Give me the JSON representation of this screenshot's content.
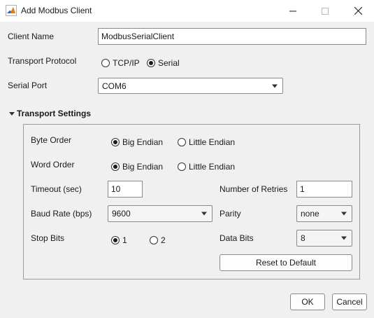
{
  "window": {
    "title": "Add Modbus Client"
  },
  "client_name": {
    "label": "Client Name",
    "value": "ModbusSerialClient"
  },
  "transport_protocol": {
    "label": "Transport Protocol",
    "options": [
      "TCP/IP",
      "Serial"
    ],
    "selected": "Serial"
  },
  "serial_port": {
    "label": "Serial Port",
    "value": "COM6"
  },
  "transport_settings": {
    "header": "Transport Settings",
    "byte_order": {
      "label": "Byte Order",
      "options": [
        "Big Endian",
        "Little Endian"
      ],
      "selected": "Big Endian"
    },
    "word_order": {
      "label": "Word Order",
      "options": [
        "Big Endian",
        "Little Endian"
      ],
      "selected": "Big Endian"
    },
    "timeout": {
      "label": "Timeout (sec)",
      "value": "10"
    },
    "retries": {
      "label": "Number of Retries",
      "value": "1"
    },
    "baud_rate": {
      "label": "Baud Rate (bps)",
      "value": "9600"
    },
    "parity": {
      "label": "Parity",
      "value": "none"
    },
    "stop_bits": {
      "label": "Stop Bits",
      "options": [
        "1",
        "2"
      ],
      "selected": "1"
    },
    "data_bits": {
      "label": "Data Bits",
      "value": "8"
    },
    "reset_label": "Reset to Default"
  },
  "buttons": {
    "ok": "OK",
    "cancel": "Cancel"
  },
  "colors": {
    "window_bg": "#f0f0f0",
    "titlebar_bg": "#ffffff",
    "icon_orange": "#e07a1f",
    "icon_blue": "#2a6cb5"
  }
}
